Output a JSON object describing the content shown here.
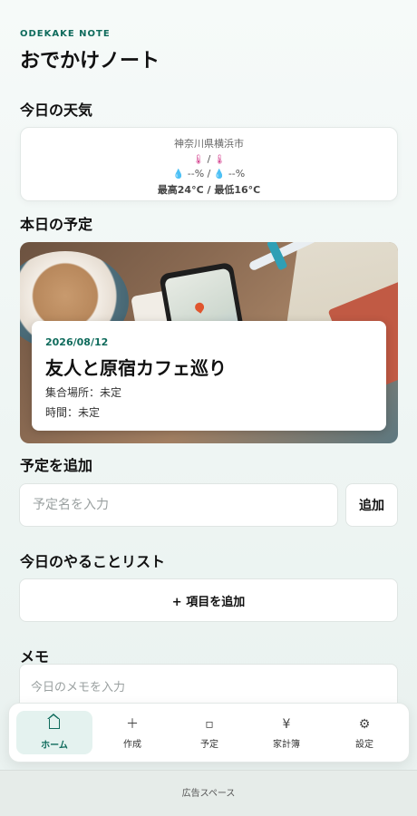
{
  "header": {
    "brand": "ODEKAKE NOTE",
    "title": "おでかけノート"
  },
  "weather": {
    "section_title": "今日の天気",
    "location": "神奈川県横浜市",
    "temp_line": "/",
    "precip_left": "--%",
    "precip_sep": "/",
    "precip_right": "--%",
    "high_low": "最高24°C / 最低16°C",
    "icons": [
      "thermometer-icon",
      "thermometer-icon",
      "droplet-icon",
      "droplet-icon"
    ]
  },
  "today_plan": {
    "section_title": "本日の予定",
    "date": "2026/08/12",
    "name": "友人と原宿カフェ巡り",
    "meeting_place": "集合場所：未定",
    "time": "時間：未定"
  },
  "add_plan": {
    "section_title": "予定を追加",
    "placeholder": "予定名を入力",
    "value": "",
    "button_label": "追加"
  },
  "todo": {
    "section_title": "今日のやることリスト",
    "add_label": "+ 項目を追加"
  },
  "memo": {
    "section_title": "メモ",
    "placeholder": "今日のメモを入力"
  },
  "tabs": [
    {
      "label": "ホーム",
      "icon": "home-icon",
      "glyph": "",
      "active": true
    },
    {
      "label": "作成",
      "icon": "plus-icon",
      "glyph": "＋",
      "active": false
    },
    {
      "label": "予定",
      "icon": "square-icon",
      "glyph": "▫",
      "active": false
    },
    {
      "label": "家計簿",
      "icon": "yen-icon",
      "glyph": "¥",
      "active": false
    },
    {
      "label": "設定",
      "icon": "gear-icon",
      "glyph": "⚙",
      "active": false
    }
  ],
  "ad": {
    "label": "広告スペース"
  },
  "colors": {
    "accent": "#0f6b5c",
    "active_tab_bg": "#e4f2ef",
    "background": "#f2f7f5"
  }
}
